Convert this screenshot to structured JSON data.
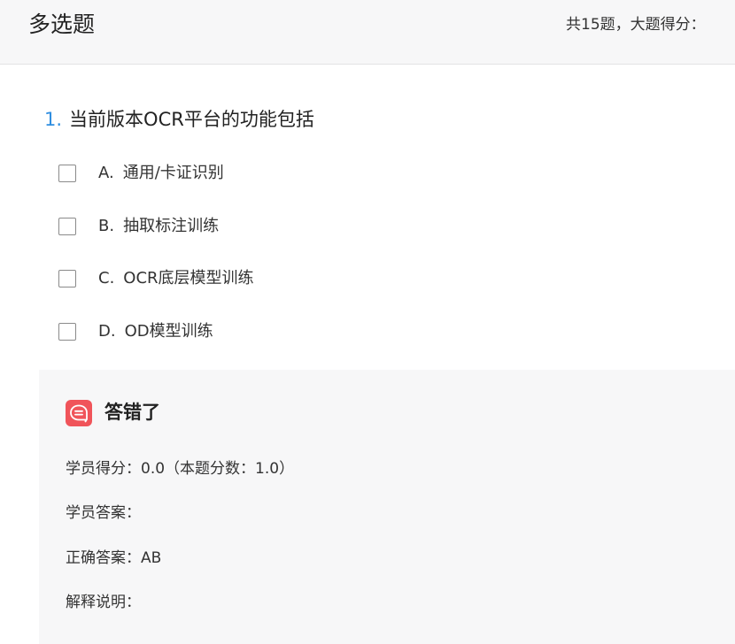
{
  "header": {
    "section_title": "多选题",
    "summary": "共15题，大题得分："
  },
  "question": {
    "number": "1.",
    "text": "当前版本OCR平台的功能包括",
    "options": [
      {
        "key": "A.",
        "text": "通用/卡证识别",
        "checked": false
      },
      {
        "key": "B.",
        "text": "抽取标注训练",
        "checked": false
      },
      {
        "key": "C.",
        "text": "OCR底层模型训练",
        "checked": false
      },
      {
        "key": "D.",
        "text": "OD模型训练",
        "checked": false
      }
    ]
  },
  "result": {
    "icon": "message-bubble-icon",
    "title": "答错了",
    "student_score": "学员得分：0.0（本题分数：1.0）",
    "student_answer": "学员答案：",
    "correct_answer": "正确答案：AB",
    "explanation": "解释说明："
  },
  "colors": {
    "accent_blue": "#2f8ee0",
    "error_red": "#f0545a",
    "panel_bg": "#f7f7f8"
  }
}
